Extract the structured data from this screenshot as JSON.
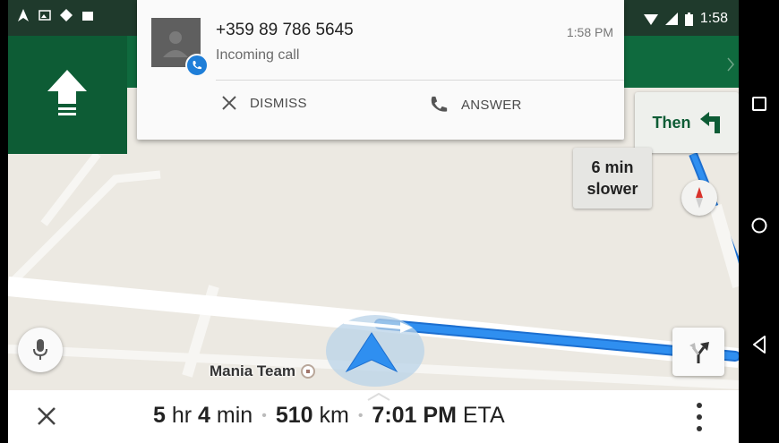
{
  "status_bar": {
    "time": "1:58",
    "left_icons": [
      "navigation-icon",
      "image-icon",
      "directions-icon",
      "photo-icon"
    ],
    "right_icons": [
      "wifi-icon",
      "signal-icon",
      "battery-icon"
    ]
  },
  "notification": {
    "caller": "+359 89 786 5645",
    "subtitle": "Incoming call",
    "time": "1:58 PM",
    "dismiss_label": "DISMISS",
    "answer_label": "ANSWER"
  },
  "navigation": {
    "then_label": "Then",
    "slower_line1": "6 min",
    "slower_line2": "slower",
    "poi_label": "Mania Team"
  },
  "trip": {
    "hours": "5",
    "hours_unit": "hr",
    "minutes": "4",
    "minutes_unit": "min",
    "distance": "510",
    "distance_unit": "km",
    "eta_time": "7:01 PM",
    "eta_label": "ETA"
  },
  "colors": {
    "nav_green": "#0d5c35",
    "route_blue": "#2f8ff0",
    "accent_blue": "#1e7ed8"
  }
}
